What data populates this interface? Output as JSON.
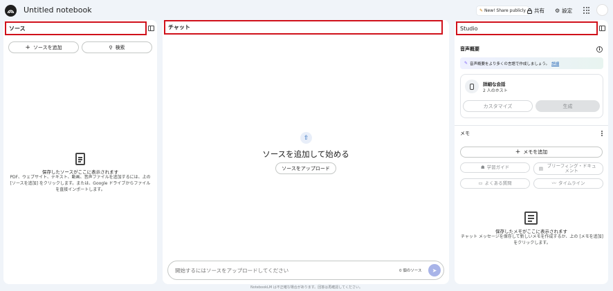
{
  "header": {
    "notebook_title": "Untitled notebook",
    "share_pill": "New! Share publicly",
    "share_label": "共有",
    "settings_label": "設定"
  },
  "sources": {
    "title": "ソース",
    "add_button": "ソースを追加",
    "search_button": "検索",
    "empty_title": "保存したソースがここに表示されます",
    "empty_body": "PDF、ウェブサイト、テキスト、動画、音声ファイルを追加するには、上の [ソースを追加] をクリックします。または、Google ドライブからファイルを直接インポートします。"
  },
  "chat": {
    "title": "チャット",
    "empty_heading": "ソースを追加して始める",
    "upload_button": "ソースをアップロード",
    "input_placeholder": "開始するにはソースをアップロードしてください",
    "source_count": "0 個のソース"
  },
  "studio": {
    "title": "Studio",
    "audio_section": "音声概要",
    "banner_text": "音声概要をより多くの言語で作成しましょう。",
    "banner_link": "詳細",
    "card_title": "詳細な会話",
    "card_subtitle": "2 人のホスト",
    "customize_button": "カスタマイズ",
    "generate_button": "生成",
    "memo_section": "メモ",
    "add_memo_button": "メモを追加",
    "study_guide": "学習ガイド",
    "briefing_doc": "ブリーフィング・ドキュメント",
    "faq": "よくある質問",
    "timeline": "タイムライン",
    "memo_empty_title": "保存したメモがここに表示されます",
    "memo_empty_body": "チャット メッセージを保存して新しいメモを作成するか、上の [メモを追加] をクリックします。"
  },
  "footer": {
    "disclaimer": "NotebookLM は不正確な場合があります。回答は再確認してください。"
  },
  "colors": {
    "highlight_box": "#d0101a",
    "page_bg": "#f0f4f9",
    "send_button": "#a8b4e8",
    "link": "#1a5fb4"
  }
}
